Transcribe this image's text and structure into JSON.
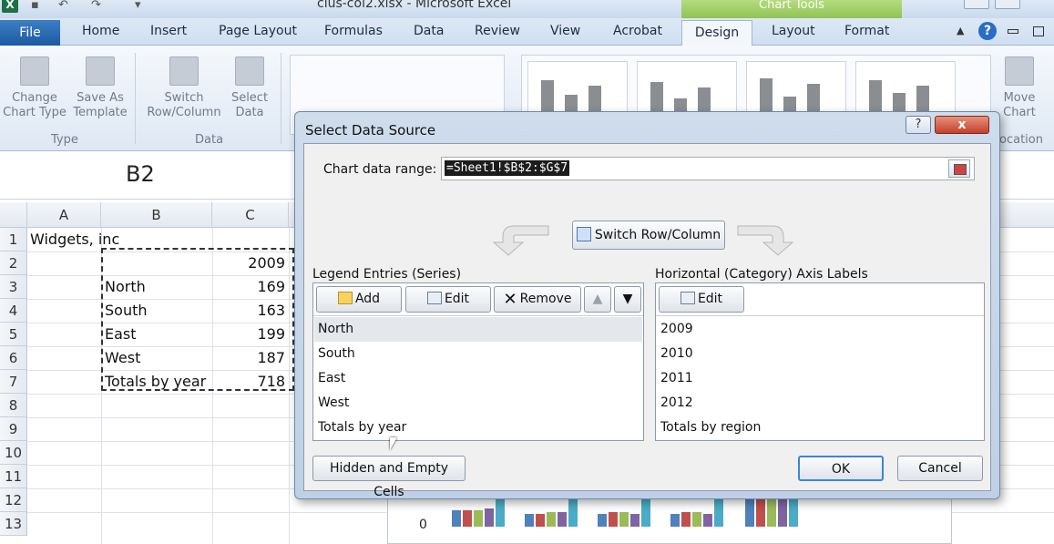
{
  "titlebar": {
    "title": "clus-col2.xlsx - Microsoft Excel",
    "app_icon_letter": "X",
    "chart_tools_label": "Chart Tools"
  },
  "tabs": {
    "file": "File",
    "items": [
      "Home",
      "Insert",
      "Page Layout",
      "Formulas",
      "Data",
      "Review",
      "View",
      "Acrobat"
    ],
    "active": "Design",
    "contextual": [
      "Layout",
      "Format"
    ]
  },
  "ribbon": {
    "change_chart_type": "Change\nChart Type",
    "save_as_template": "Save As\nTemplate",
    "group_type": "Type",
    "switch_row_column": "Switch\nRow/Column",
    "select_data": "Select\nData",
    "group_data": "Data",
    "move_chart": "Move\nChart",
    "group_location": "ocation"
  },
  "formula_bar": {
    "name_box": "B2"
  },
  "sheet": {
    "columns": [
      "A",
      "B",
      "C"
    ],
    "rows": [
      "1",
      "2",
      "3",
      "4",
      "5",
      "6",
      "7",
      "8",
      "9",
      "10",
      "11",
      "12",
      "13"
    ],
    "a1": "Widgets, inc",
    "c2": "2009",
    "data_rows": [
      {
        "label": "North",
        "value": "169"
      },
      {
        "label": "South",
        "value": "163"
      },
      {
        "label": "East",
        "value": "199"
      },
      {
        "label": "West",
        "value": "187"
      },
      {
        "label": "Totals by year",
        "value": "718"
      }
    ],
    "chart_zero_label": "0"
  },
  "dialog": {
    "title": "Select Data Source",
    "help": "?",
    "close": "x",
    "range_label": "Chart data range:",
    "range_value": "=Sheet1!$B$2:$G$7",
    "switch_button": "Switch Row/Column",
    "legend_label": "Legend Entries (Series)",
    "axis_label": "Horizontal (Category) Axis Labels",
    "add": "Add",
    "edit": "Edit",
    "remove": "Remove",
    "axis_edit": "Edit",
    "series": [
      "North",
      "South",
      "East",
      "West",
      "Totals by year"
    ],
    "categories": [
      "2009",
      "2010",
      "2011",
      "2012",
      "Totals by region"
    ],
    "hidden_empty": "Hidden and Empty Cells",
    "ok": "OK",
    "cancel": "Cancel"
  }
}
